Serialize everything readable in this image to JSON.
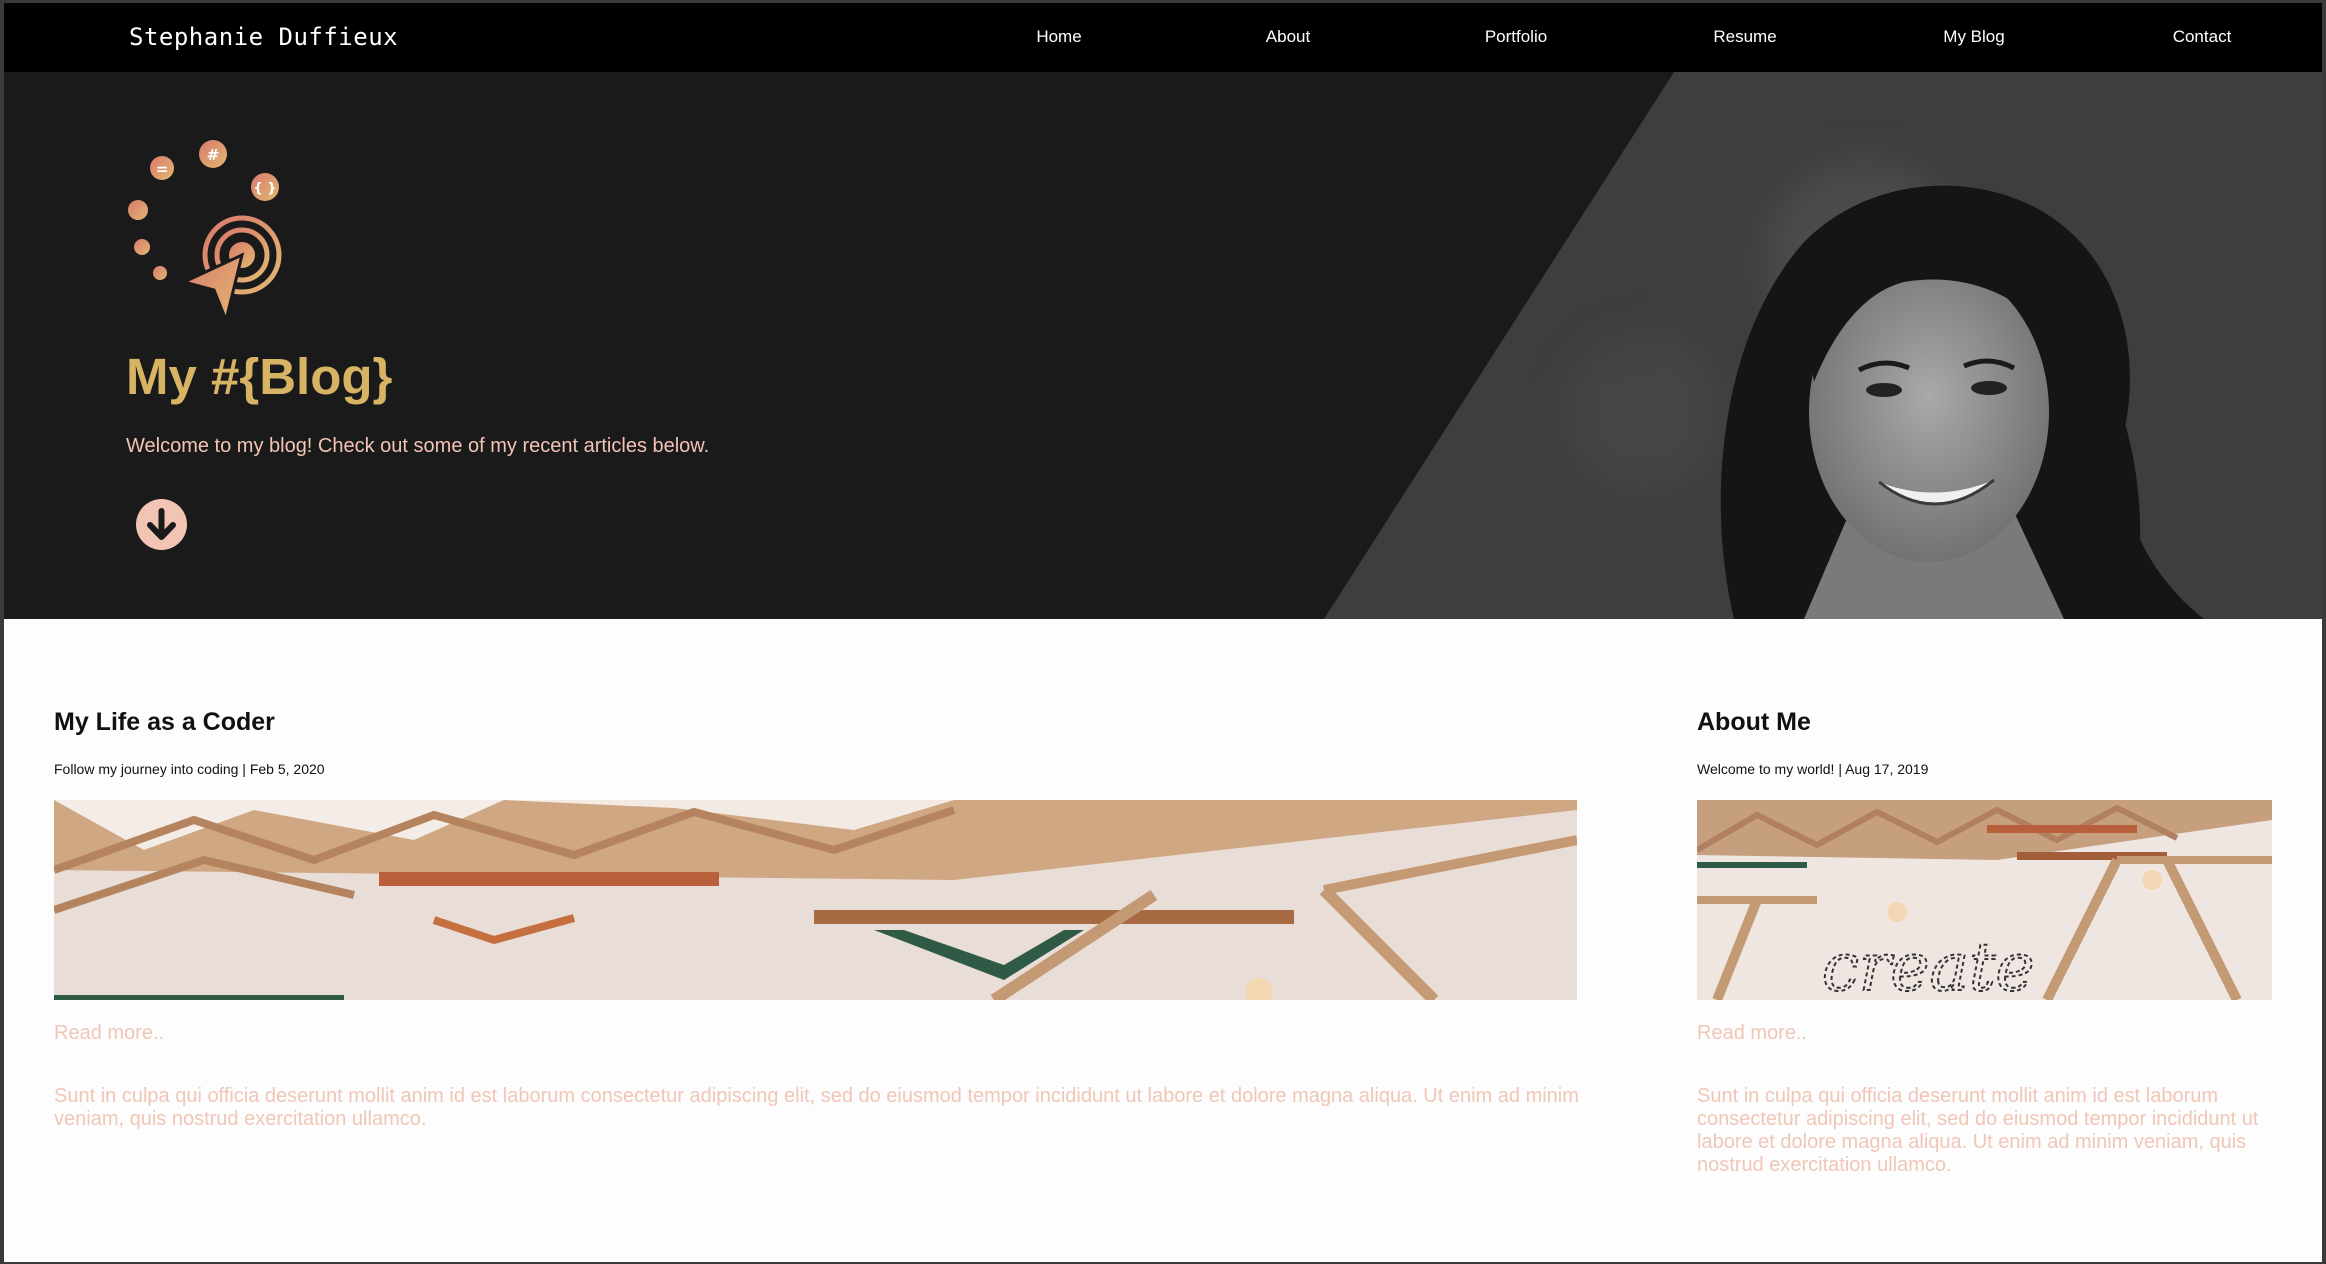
{
  "brand": "Stephanie Duffieux",
  "nav": [
    "Home",
    "About",
    "Portfolio",
    "Resume",
    "My Blog",
    "Contact"
  ],
  "hero": {
    "title": "My #{Blog}",
    "subtitle": "Welcome to my blog! Check out some of my recent articles below.",
    "logo_glyphs": {
      "equals": "=",
      "hash": "#",
      "braces": "{ }"
    }
  },
  "posts": [
    {
      "title": "My Life as a Coder",
      "meta": "Follow my journey into coding | Feb 5, 2020",
      "read_more": "Read more..",
      "excerpt": "Sunt in culpa qui officia deserunt mollit anim id est laborum consectetur adipiscing elit, sed do eiusmod tempor incididunt ut labore et dolore magna aliqua. Ut enim ad minim veniam, quis nostrud exercitation ullamco."
    },
    {
      "title": "About Me",
      "meta": "Welcome to my world! | Aug 17, 2019",
      "read_more": "Read more..",
      "excerpt": "Sunt in culpa qui officia deserunt mollit anim id est laborum consectetur adipiscing elit, sed do eiusmod tempor incididunt ut labore et dolore magna aliqua. Ut enim ad minim veniam, quis nostrud exercitation ullamco.",
      "image_text": "create"
    }
  ],
  "colors": {
    "accent_gold": "#d7b463",
    "accent_pink": "#f2c4b4",
    "hero_bg": "#1b1a1b",
    "nav_bg": "#000000"
  }
}
